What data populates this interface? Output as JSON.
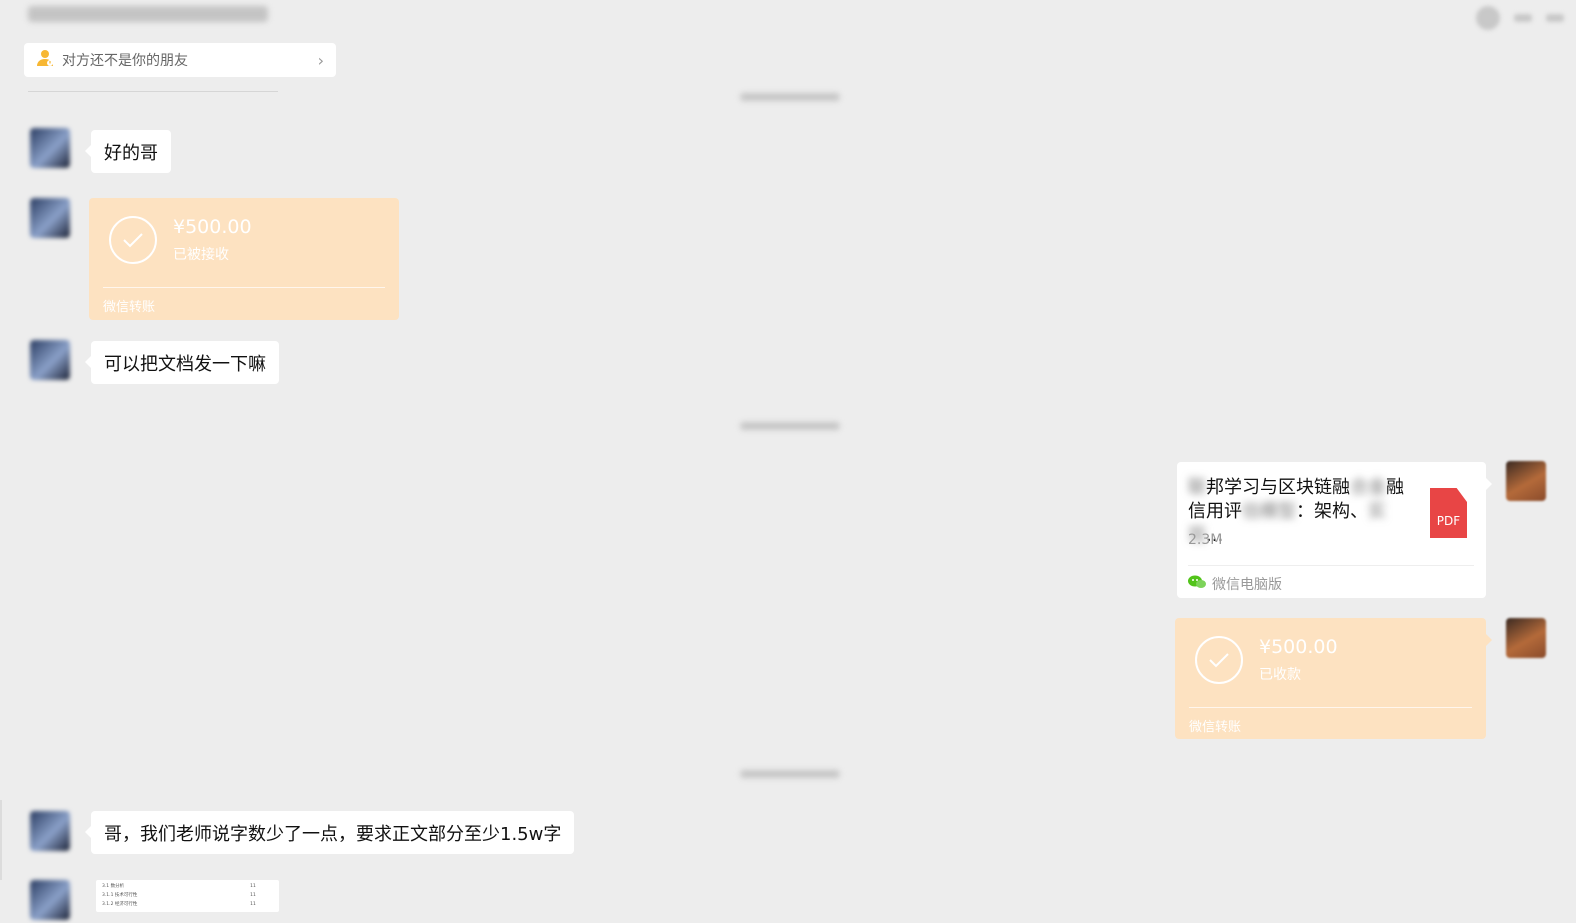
{
  "header": {
    "title_blurred": true
  },
  "friend_notice": {
    "icon": "person-warning-icon",
    "text": "对方还不是你的朋友"
  },
  "messages": [
    {
      "side": "left",
      "type": "text",
      "text": "好的哥"
    },
    {
      "side": "left",
      "type": "transfer",
      "amount": "¥500.00",
      "status": "已被接收",
      "footer": "微信转账"
    },
    {
      "side": "left",
      "type": "text",
      "text": "可以把文档发一下嘛"
    },
    {
      "side": "right",
      "type": "file",
      "title_visible_part_1": "邦学习与区块链融",
      "title_visible_part_2": "融",
      "title_visible_part_3": "信用评",
      "title_visible_part_4": "：架构、",
      "size": "2.3M",
      "file_type": "PDF",
      "source": "微信电脑版"
    },
    {
      "side": "right",
      "type": "transfer",
      "amount": "¥500.00",
      "status": "已收款",
      "footer": "微信转账"
    },
    {
      "side": "left",
      "type": "text",
      "text": "哥，我们老师说字数少了一点，要求正文部分至少1.5w字"
    },
    {
      "side": "left",
      "type": "image",
      "lines": [
        {
          "text": "3.1 数分析",
          "page": "11"
        },
        {
          "text": "3.1.1 技术可行性",
          "page": "11"
        },
        {
          "text": "3.1.2 经济可行性",
          "page": "11"
        }
      ]
    }
  ],
  "colors": {
    "background": "#ededed",
    "bubble": "#ffffff",
    "transfer": "#fde2c1",
    "pdf": "#e84545"
  }
}
